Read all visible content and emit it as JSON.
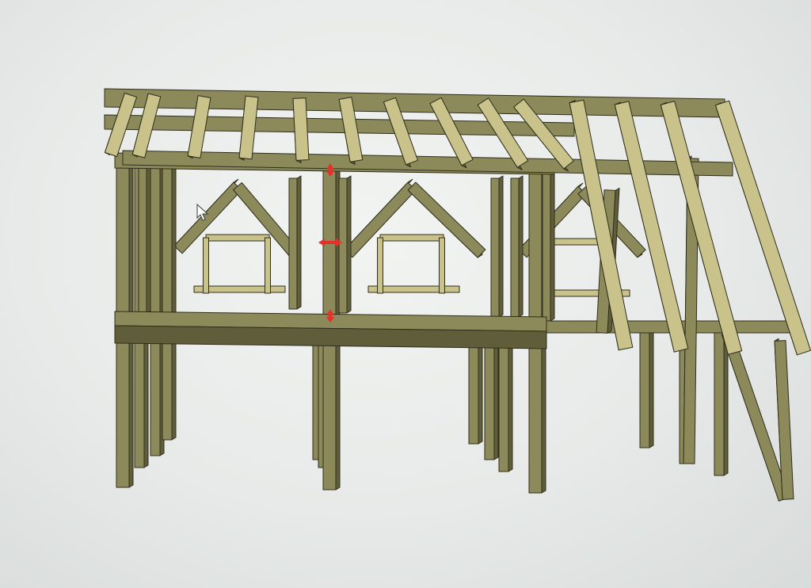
{
  "viewport": {
    "background": "#eceeed"
  },
  "model": {
    "subject": "timber-frame-structure",
    "colors": {
      "timber_face": "#8c8a5a",
      "timber_light": "#c9c28a",
      "timber_dark": "#5f5d3a",
      "edge": "#2f2e1c",
      "marker": "#e8302a"
    },
    "markers": [
      "dimension-arrow-top",
      "dimension-arrow-middle",
      "dimension-arrow-bottom"
    ]
  },
  "cursor": {
    "type": "arrow-pointer",
    "color": "#ffffff"
  }
}
